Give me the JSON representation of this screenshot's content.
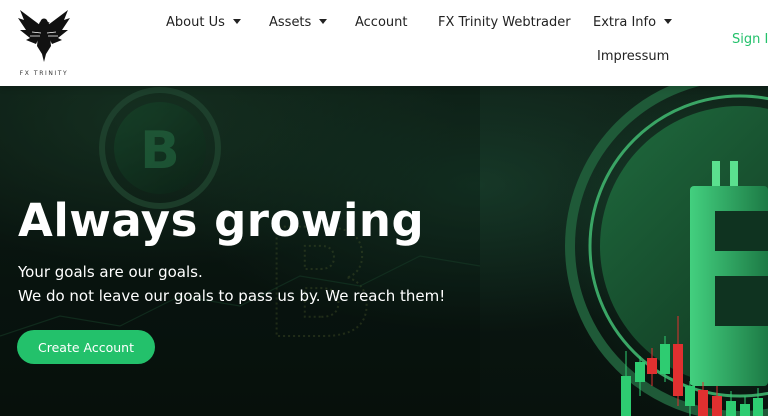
{
  "brand": {
    "name": "FX TRINITY",
    "logo_icon": "eagle-icon"
  },
  "nav": {
    "about": "About Us",
    "assets": "Assets",
    "account": "Account",
    "webtrader": "FX Trinity Webtrader",
    "extra": "Extra Info",
    "impressum": "Impressum",
    "signin": "Sign In"
  },
  "hero": {
    "title": "Always growing",
    "line1": "Your goals are our goals.",
    "line2": "We do not leave our goals to pass us by. We reach them!",
    "cta": "Create Account",
    "background": "bitcoin-chart-background"
  },
  "colors": {
    "accent": "#23c16b",
    "hero_bg": "#0a1611",
    "candle_up": "#2ecc71",
    "candle_down": "#e03030"
  }
}
